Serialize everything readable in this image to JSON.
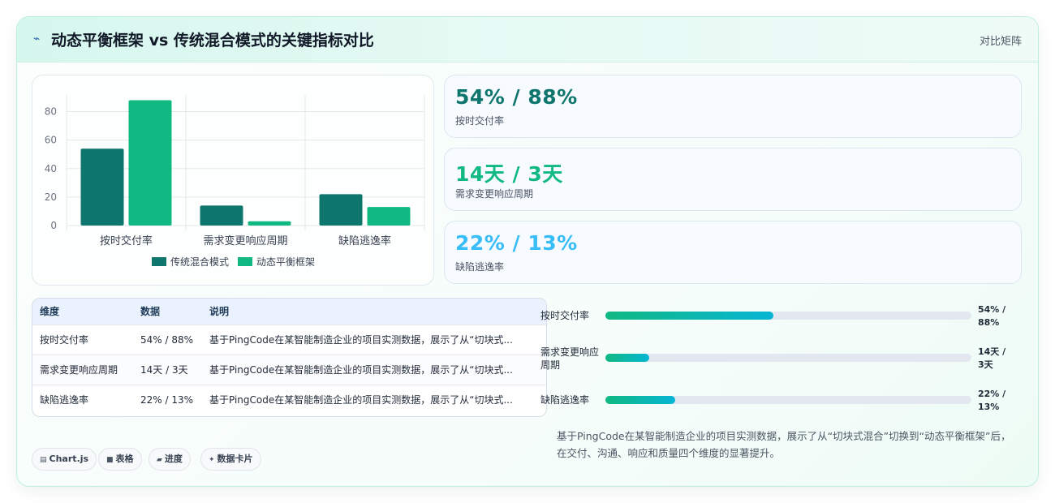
{
  "header": {
    "icon": "lightning-icon",
    "title": "动态平衡框架 vs 传统混合模式的关键指标对比",
    "tag": "对比矩阵"
  },
  "colors": {
    "traditional": "#0f766e",
    "dynamic": "#10b981",
    "stat1": "#0f766e",
    "stat2": "#10b981",
    "stat3": "#38bdf8"
  },
  "chart_data": {
    "type": "bar",
    "categories": [
      "按时交付率",
      "需求变更响应周期",
      "缺陷逃逸率"
    ],
    "series": [
      {
        "name": "传统混合模式",
        "values": [
          54,
          14,
          22
        ]
      },
      {
        "name": "动态平衡框架",
        "values": [
          88,
          3,
          13
        ]
      }
    ],
    "yticks": [
      0,
      20,
      40,
      60,
      80
    ],
    "ylim": [
      0,
      90
    ],
    "grid": true,
    "legend": "bottom",
    "xlabel": "",
    "ylabel": ""
  },
  "stats": [
    {
      "value": "54% / 88%",
      "label": "按时交付率"
    },
    {
      "value": "14天 / 3天",
      "label": "需求变更响应周期"
    },
    {
      "value": "22% / 13%",
      "label": "缺陷逃逸率"
    }
  ],
  "table": {
    "headers": [
      "维度",
      "数据",
      "说明"
    ],
    "rows": [
      {
        "dim": "按时交付率",
        "data": "54% / 88%",
        "desc": "基于PingCode在某智能制造企业的项目实测数据，展示了从“切块式..."
      },
      {
        "dim": "需求变更响应周期",
        "data": "14天 / 3天",
        "desc": "基于PingCode在某智能制造企业的项目实测数据，展示了从“切块式..."
      },
      {
        "dim": "缺陷逃逸率",
        "data": "22% / 13%",
        "desc": "基于PingCode在某智能制造企业的项目实测数据，展示了从“切块式..."
      }
    ]
  },
  "progress": [
    {
      "label": "按时交付率",
      "value": "54% / 88%",
      "fill": 0.46
    },
    {
      "label": "需求变更响应周期",
      "value": "14天 / 3天",
      "fill": 0.12
    },
    {
      "label": "缺陷逃逸率",
      "value": "22% / 13%",
      "fill": 0.19
    }
  ],
  "summary": "基于PingCode在某智能制造企业的项目实测数据，展示了从“切块式混合”切换到“动态平衡框架”后，在交付、沟通、响应和质量四个维度的显著提升。",
  "chips": [
    {
      "icon": "chart-icon",
      "glyph": "▤",
      "label": "Chart.js"
    },
    {
      "icon": "table-icon",
      "glyph": "■",
      "label": "表格"
    },
    {
      "icon": "progress-icon",
      "glyph": "▰",
      "label": "进度"
    },
    {
      "icon": "sparkle-icon",
      "glyph": "✦",
      "label": "数据卡片"
    }
  ]
}
